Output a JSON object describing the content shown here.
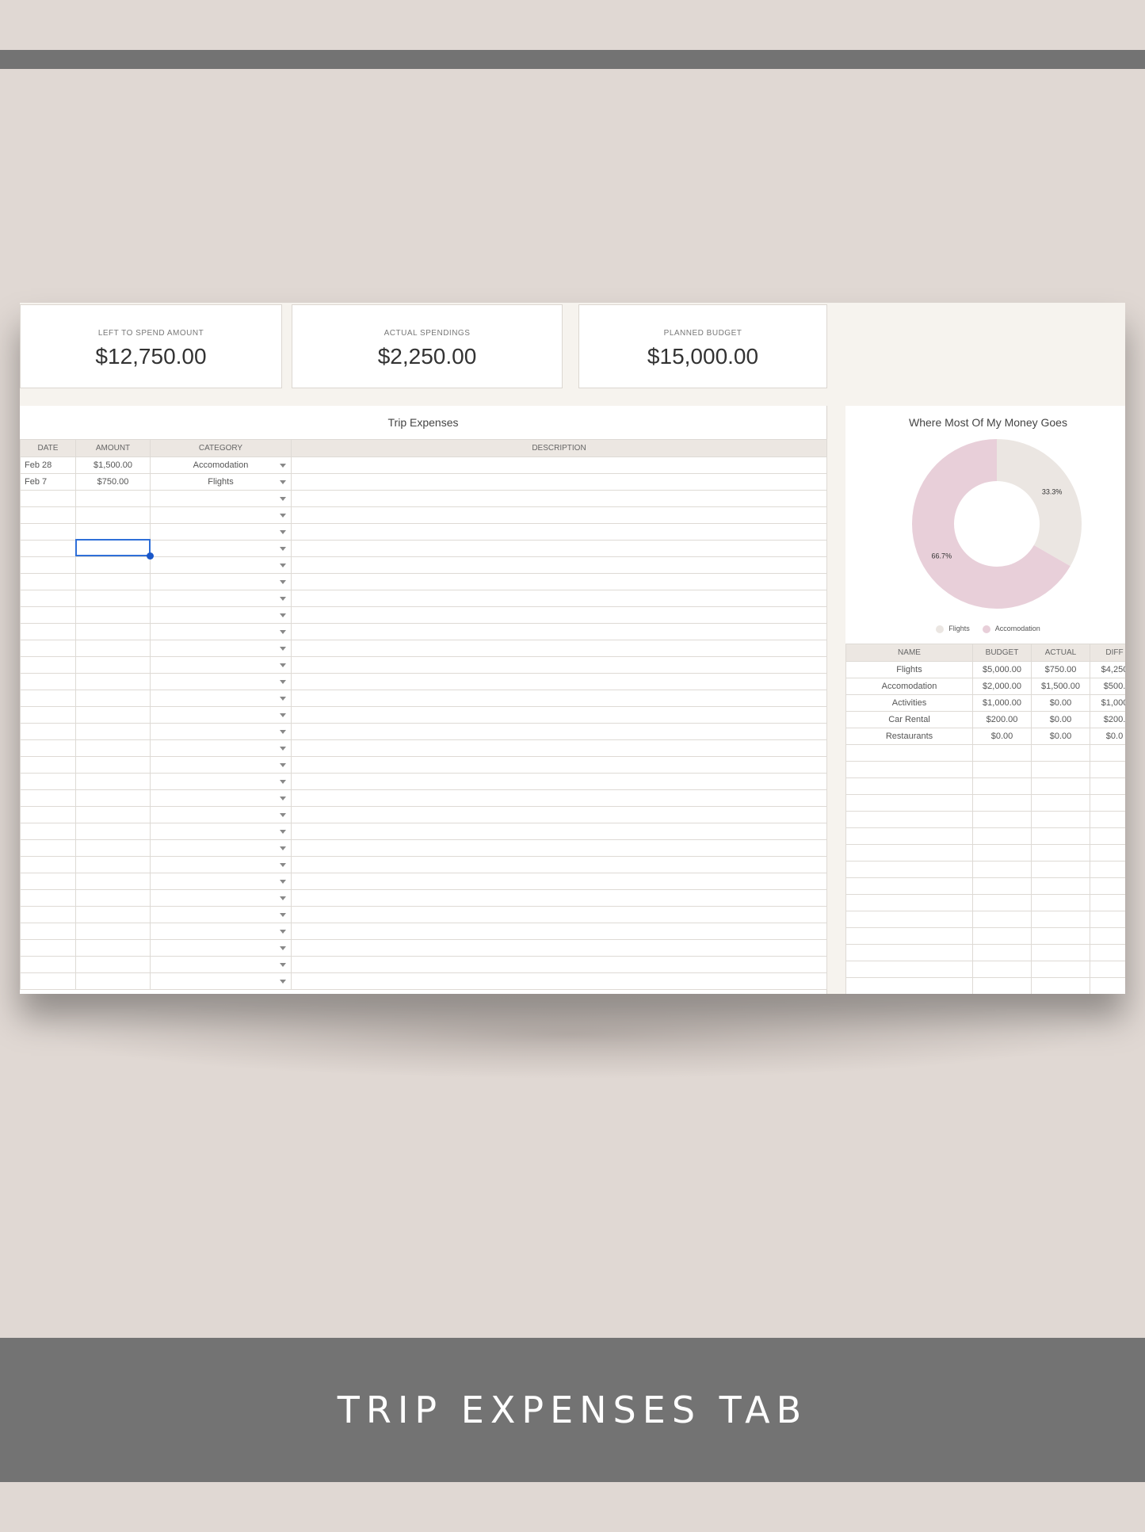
{
  "cards": [
    {
      "label": "LEFT TO SPEND AMOUNT",
      "value": "$12,750.00"
    },
    {
      "label": "ACTUAL SPENDINGS",
      "value": "$2,250.00"
    },
    {
      "label": "PLANNED BUDGET",
      "value": "$15,000.00"
    }
  ],
  "expenses": {
    "title": "Trip Expenses",
    "headers": {
      "date": "DATE",
      "amount": "AMOUNT",
      "category": "CATEGORY",
      "description": "DESCRIPTION"
    },
    "rows": [
      {
        "date": "Feb 28",
        "amount": "$1,500.00",
        "category": "Accomodation",
        "description": ""
      },
      {
        "date": "Feb 7",
        "amount": "$750.00",
        "category": "Flights",
        "description": ""
      }
    ],
    "empty_row_count": 30
  },
  "chart_data": {
    "type": "pie",
    "title": "Where Most Of My Money Goes",
    "categories": [
      "Flights",
      "Accomodation"
    ],
    "values": [
      33.3,
      66.7
    ],
    "labels": [
      "33.3%",
      "66.7%"
    ],
    "colors": [
      "#ebe6e2",
      "#e8cfd9"
    ],
    "legend_position": "bottom"
  },
  "summary": {
    "headers": {
      "name": "NAME",
      "budget": "BUDGET",
      "actual": "ACTUAL",
      "diff": "DIFF"
    },
    "rows": [
      {
        "name": "Flights",
        "budget": "$5,000.00",
        "actual": "$750.00",
        "diff": "$4,250"
      },
      {
        "name": "Accomodation",
        "budget": "$2,000.00",
        "actual": "$1,500.00",
        "diff": "$500."
      },
      {
        "name": "Activities",
        "budget": "$1,000.00",
        "actual": "$0.00",
        "diff": "$1,000"
      },
      {
        "name": "Car Rental",
        "budget": "$200.00",
        "actual": "$0.00",
        "diff": "$200."
      },
      {
        "name": "Restaurants",
        "budget": "$0.00",
        "actual": "$0.00",
        "diff": "$0.0"
      }
    ],
    "empty_row_count": 15
  },
  "banner": {
    "title": "TRIP EXPENSES TAB"
  }
}
